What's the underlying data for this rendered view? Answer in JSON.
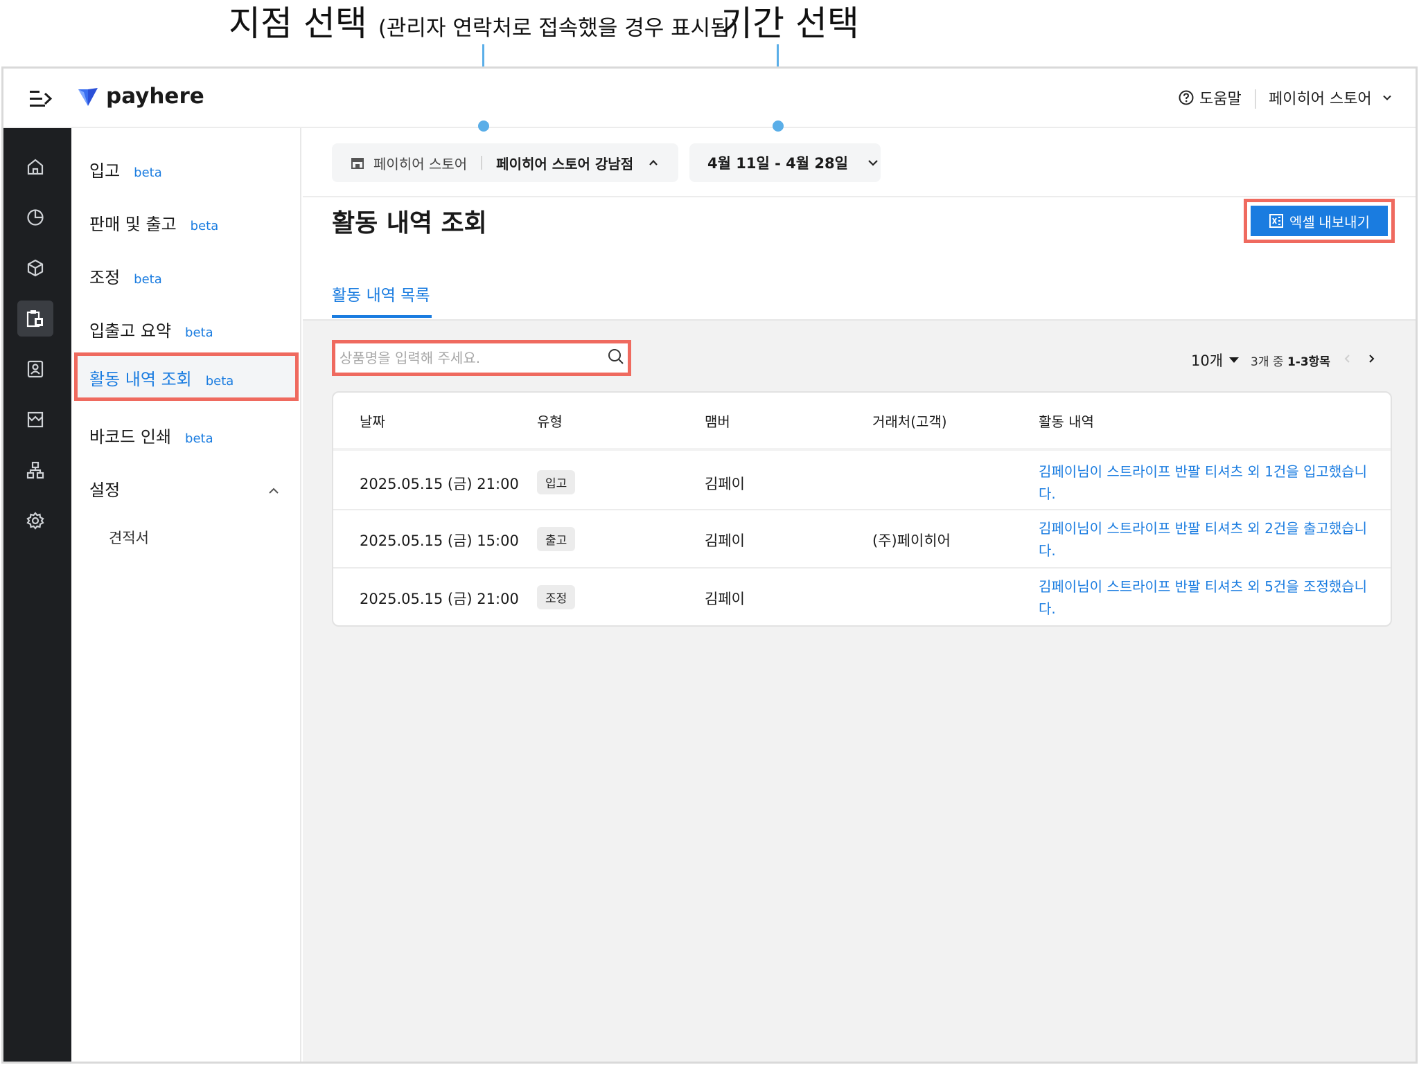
{
  "annotations": {
    "branch_title": "지점 선택",
    "branch_note": "(관리자 연락처로 접속했을 경우 표시됨)",
    "period_title": "기간 선택"
  },
  "header": {
    "logo_text": "payhere",
    "help_label": "도움말",
    "store_name": "페이히어 스토어"
  },
  "rail": {
    "icons": [
      "home-icon",
      "chart-icon",
      "box-icon",
      "clipboard-icon",
      "contact-icon",
      "store-icon",
      "org-icon",
      "gear-icon"
    ]
  },
  "subnav": {
    "items": [
      {
        "label": "입고",
        "badge": "beta"
      },
      {
        "label": "판매 및 출고",
        "badge": "beta"
      },
      {
        "label": "조정",
        "badge": "beta"
      },
      {
        "label": "입출고 요약",
        "badge": "beta"
      },
      {
        "label": "활동 내역 조회",
        "badge": "beta"
      },
      {
        "label": "바코드 인쇄",
        "badge": "beta"
      }
    ],
    "settings_label": "설정",
    "settings_sub": "견적서"
  },
  "filters": {
    "store": "페이히어 스토어",
    "branch": "페이히어 스토어 강남점",
    "period": "4월 11일 - 4월 28일"
  },
  "page": {
    "title": "활동 내역 조회",
    "export_label": "엑셀 내보내기",
    "tab_label": "활동 내역 목록",
    "search_placeholder": "상품명을 입력해 주세요."
  },
  "pager": {
    "per_page": "10개",
    "range_prefix": "3개 중",
    "range": "1-3항목"
  },
  "table": {
    "headers": [
      "날짜",
      "유형",
      "맴버",
      "거래처(고객)",
      "활동 내역"
    ],
    "rows": [
      {
        "date": "2025.05.15 (금) 21:00",
        "type": "입고",
        "member": "김페이",
        "partner": "",
        "activity": "김페이님이 스트라이프 반팔 티셔츠 외 1건을 입고했습니다."
      },
      {
        "date": "2025.05.15 (금) 15:00",
        "type": "출고",
        "member": "김페이",
        "partner": "(주)페이히어",
        "activity": "김페이님이 스트라이프 반팔 티셔츠 외 2건을 출고했습니다."
      },
      {
        "date": "2025.05.15 (금) 21:00",
        "type": "조정",
        "member": "김페이",
        "partner": "",
        "activity": "김페이님이 스트라이프 반팔 티셔츠 외 5건을 조정했습니다."
      }
    ]
  },
  "colors": {
    "accent": "#1a7ce0",
    "highlight": "#ef6a5f",
    "annotation_pin": "#5aaee8",
    "rail": "#1d1f22"
  }
}
